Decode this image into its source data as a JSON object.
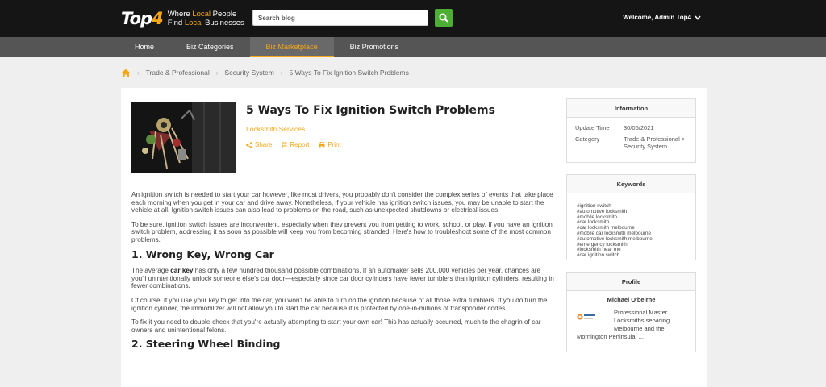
{
  "header": {
    "logo_top": "Top",
    "logo_four": "4",
    "tagline_l1_a": "Where ",
    "tagline_l1_b": "Local",
    "tagline_l1_c": " People",
    "tagline_l2_a": "Find ",
    "tagline_l2_b": "Local",
    "tagline_l2_c": " Businesses",
    "search_placeholder": "Search blog",
    "welcome": "Welcome, Admin Top4"
  },
  "nav": {
    "items": [
      "Home",
      "Biz Categories",
      "Biz Marketplace",
      "Biz Promotions"
    ],
    "active": "Biz Marketplace"
  },
  "breadcrumb": [
    "Trade & Professional",
    "Security System",
    "5 Ways To Fix Ignition Switch Problems"
  ],
  "article": {
    "title": "5 Ways To Fix Ignition Switch Problems",
    "category": "Locksmith Services",
    "share": "Share",
    "report": "Report",
    "print": "Print",
    "p1": "An ignition switch is needed to start your car however, like most drivers, you probably don't consider the complex series of events that take place each morning when you get in your car and drive away. Nonetheless, if your vehicle has ignition switch issues, you may be unable to start the vehicle at all. Ignition switch issues can also lead to problems on the road, such as unexpected shutdowns or electrical issues.",
    "p2": "To be sure, ignition switch issues are inconvenient, especially when they prevent you from getting to work, school, or play. If you have an ignition switch problem, addressing it as soon as possible will keep you from becoming stranded. Here's how to troubleshoot some of the most common problems.",
    "h1": "1. Wrong Key, Wrong Car",
    "p3_a": "The average ",
    "p3_b": "car key",
    "p3_c": " has only a few hundred thousand possible combinations. If an automaker sells 200,000 vehicles per year, chances are you'll unintentionally unlock someone else's car door—especially since car door cylinders have fewer tumblers than ignition cylinders, resulting in fewer combinations.",
    "p4": "Of course, if you use your key to get into the car, you won't be able to turn on the ignition because of all those extra tumblers. If you do turn the ignition cylinder, the immobilizer will not allow you to start the car because it is protected by one-in-millions of transponder codes.",
    "p5": "To fix it you need to double-check that you're actually attempting to start your own car! This has actually occurred, much to the chagrin of car owners and unintentional felons.",
    "h2": "2. Steering Wheel Binding"
  },
  "sidebar": {
    "info_title": "Information",
    "update_label": "Update Time",
    "update_value": "30/06/2021",
    "category_label": "Category",
    "category_value": "Trade & Professional > Security System",
    "keywords_title": "Keywords",
    "keywords": [
      "#ignition switch",
      "#automotive locksmith",
      "#mobile locksmith",
      "#car locksmith",
      "#car locksmith melbourne",
      "#mobile car locksmith melbourne",
      "#automotive locksmith melbourne",
      "#emergency locksmith",
      "#locksmith near me",
      "#car ignition switch"
    ],
    "profile_title": "Profile",
    "profile_name": "Michael O'beirne",
    "profile_desc_1": "Professional Master Locksmiths servicing Melbourne and the",
    "profile_desc_2": "Mornington Peninsula. ..."
  },
  "colors": {
    "accent": "#f4a818",
    "search_button": "#4caf33",
    "topbar": "#151515",
    "nav": "#555555"
  }
}
